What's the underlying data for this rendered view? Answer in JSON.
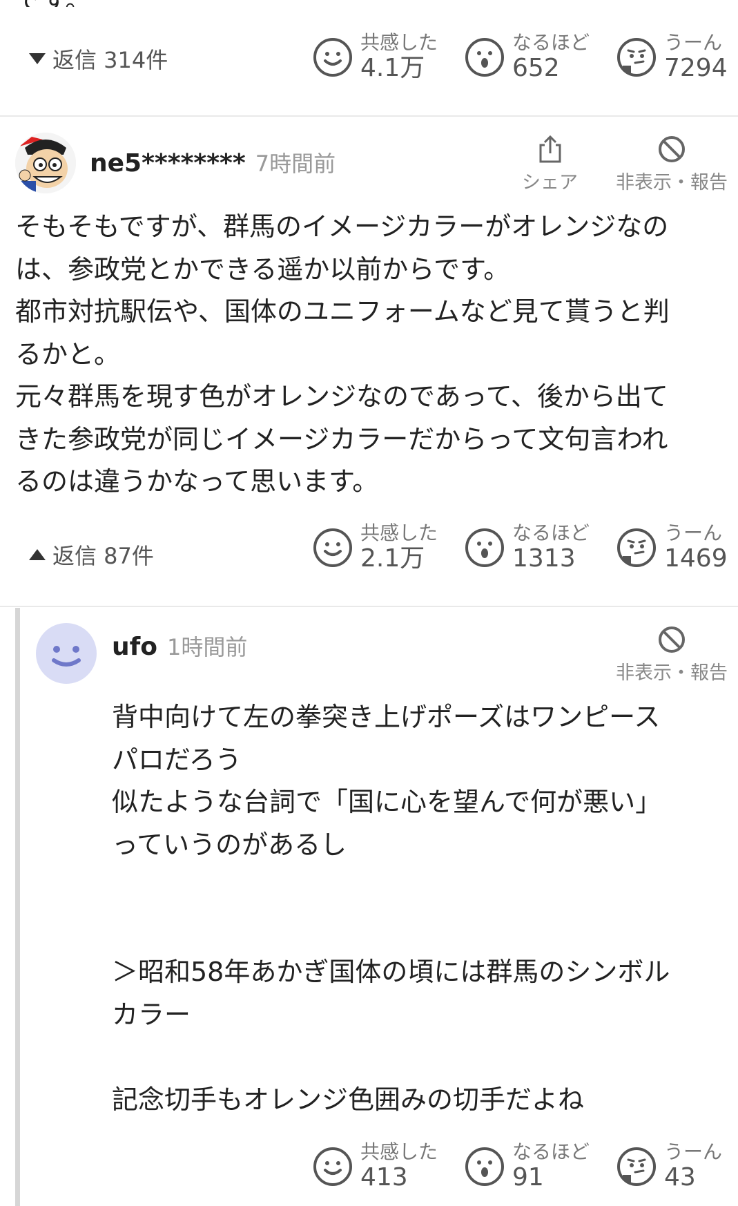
{
  "top_partial_text": "です。",
  "comment1_footer": {
    "reply_toggle": "返信 314件",
    "reactions": [
      {
        "label": "共感した",
        "count": "4.1万",
        "icon": "smile-icon"
      },
      {
        "label": "なるほど",
        "count": "652",
        "icon": "surprised-icon"
      },
      {
        "label": "うーん",
        "count": "7294",
        "icon": "thinking-icon"
      }
    ]
  },
  "comment2": {
    "username": "ne5********",
    "time": "7時間前",
    "share_label": "シェア",
    "hide_report_label": "非表示・報告",
    "text_lines": [
      "そもそもですが、群馬のイメージカラーがオレンジなの",
      "は、参政党とかできる遥か以前からです。",
      "都市対抗駅伝や、国体のユニフォームなど見て貰うと判",
      "るかと。",
      "元々群馬を現す色がオレンジなのであって、後から出て",
      "きた参政党が同じイメージカラーだからって文句言われ",
      "るのは違うかなって思います。"
    ],
    "reply_toggle": "返信 87件",
    "reactions": [
      {
        "label": "共感した",
        "count": "2.1万",
        "icon": "smile-icon"
      },
      {
        "label": "なるほど",
        "count": "1313",
        "icon": "surprised-icon"
      },
      {
        "label": "うーん",
        "count": "1469",
        "icon": "thinking-icon"
      }
    ]
  },
  "reply1": {
    "username": "ufo",
    "time": "1時間前",
    "hide_report_label": "非表示・報告",
    "text_lines": [
      "背中向けて左の拳突き上げポーズはワンピース",
      "パロだろう",
      "似たような台詞で「国に心を望んで何が悪い」",
      "っていうのがあるし",
      "",
      "",
      "",
      "＞昭和58年あかぎ国体の頃には群馬のシンボル",
      "カラー",
      "",
      "記念切手もオレンジ色囲みの切手だよね"
    ],
    "reactions": [
      {
        "label": "共感した",
        "count": "413",
        "icon": "smile-icon"
      },
      {
        "label": "なるほど",
        "count": "91",
        "icon": "surprised-icon"
      },
      {
        "label": "うーん",
        "count": "43",
        "icon": "thinking-icon"
      }
    ]
  }
}
